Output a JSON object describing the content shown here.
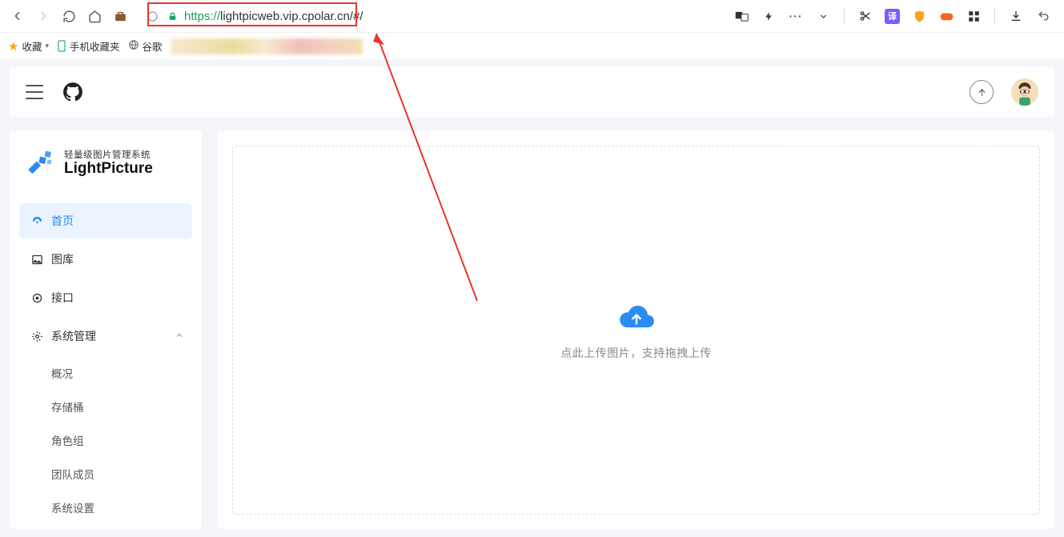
{
  "browser": {
    "url_https": "https://",
    "url_rest": "lightpicweb.vip.cpolar.cn/#/"
  },
  "bookmarks": {
    "fav_label": "收藏",
    "mobile_label": "手机收藏夹",
    "google_label": "谷歌"
  },
  "logo": {
    "sub": "轻量级图片管理系统",
    "main": "LightPicture"
  },
  "sidebar": {
    "home": "首页",
    "gallery": "图库",
    "api": "接口",
    "system": "系统管理",
    "sub": {
      "overview": "概况",
      "bucket": "存储桶",
      "role": "角色组",
      "team": "团队成员",
      "settings": "系统设置"
    }
  },
  "main": {
    "drop_text": "点此上传图片，支持拖拽上传"
  }
}
